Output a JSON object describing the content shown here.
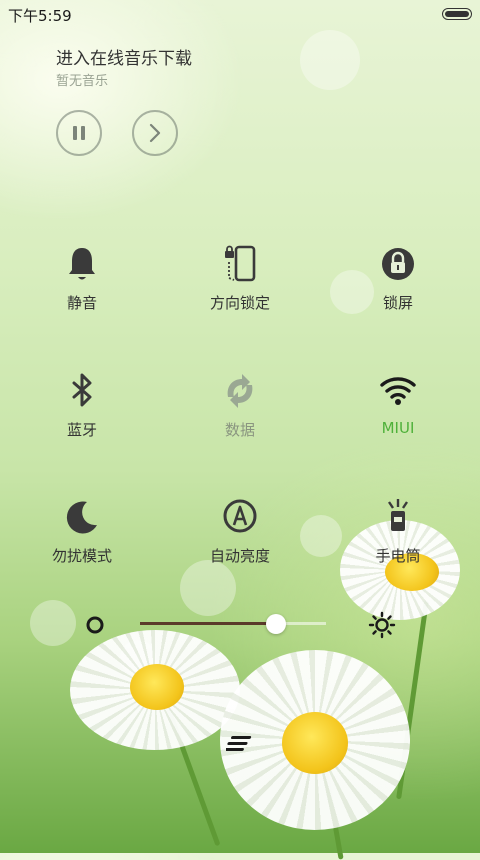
{
  "status_bar": {
    "time": "下午5:59",
    "battery_icon": "battery-icon"
  },
  "music": {
    "title": "进入在线音乐下载",
    "subtitle": "暂无音乐",
    "pause_icon": "pause-icon",
    "next_icon": "next-icon"
  },
  "toggles": [
    {
      "label": "静音",
      "icon": "bell-icon",
      "state": "off"
    },
    {
      "label": "方向锁定",
      "icon": "rotation-lock-icon",
      "state": "off"
    },
    {
      "label": "锁屏",
      "icon": "lock-icon",
      "state": "off"
    },
    {
      "label": "蓝牙",
      "icon": "bluetooth-icon",
      "state": "off"
    },
    {
      "label": "数据",
      "icon": "mobile-data-icon",
      "state": "disabled"
    },
    {
      "label": "MIUI",
      "icon": "wifi-icon",
      "state": "on"
    },
    {
      "label": "勿扰模式",
      "icon": "moon-icon",
      "state": "off"
    },
    {
      "label": "自动亮度",
      "icon": "auto-brightness-icon",
      "state": "off"
    },
    {
      "label": "手电筒",
      "icon": "flashlight-icon",
      "state": "off"
    }
  ],
  "brightness": {
    "value": 0.73,
    "min_icon": "brightness-low-icon",
    "max_icon": "brightness-high-icon"
  },
  "colors": {
    "active": "#4fb13a",
    "icon": "#3a3a3a",
    "dim": "#8a9580"
  },
  "handle_icon": "menu-handle-icon"
}
